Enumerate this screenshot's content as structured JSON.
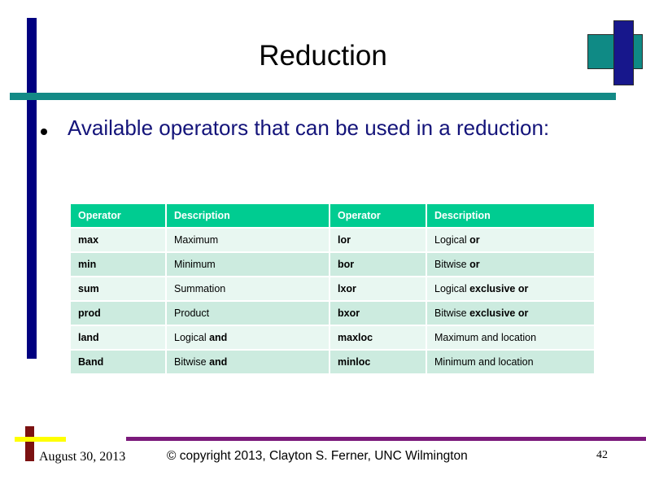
{
  "slide": {
    "title": "Reduction",
    "bullet": "Available operators that can be used in a reduction:",
    "accent_teal": "#138a86",
    "accent_navy": "#000080",
    "accent_bright_green": "#00cc91",
    "accent_purple": "#7b1a7b",
    "accent_dark_red": "#7b1111",
    "accent_yellow": "#ffff00",
    "bullet_text_color": "#14147a"
  },
  "table": {
    "headers": [
      "Operator",
      "Description",
      "Operator",
      "Description"
    ],
    "rows": [
      {
        "op1": "max",
        "desc1_plain": "Maximum",
        "desc1_bold": "",
        "op2": "lor",
        "desc2_plain": "Logical ",
        "desc2_bold": "or"
      },
      {
        "op1": "min",
        "desc1_plain": "Minimum",
        "desc1_bold": "",
        "op2": "bor",
        "desc2_plain": "Bitwise ",
        "desc2_bold": "or"
      },
      {
        "op1": "sum",
        "desc1_plain": "Summation",
        "desc1_bold": "",
        "op2": "lxor",
        "desc2_plain": "Logical ",
        "desc2_bold": "exclusive or"
      },
      {
        "op1": "prod",
        "desc1_plain": "Product",
        "desc1_bold": "",
        "op2": "bxor",
        "desc2_plain": "Bitwise ",
        "desc2_bold": "exclusive or"
      },
      {
        "op1": "land",
        "desc1_plain": "Logical ",
        "desc1_bold": "and",
        "op2": "maxloc",
        "desc2_plain": "Maximum and location",
        "desc2_bold": ""
      },
      {
        "op1": "Band",
        "desc1_plain": "Bitwise ",
        "desc1_bold": "and",
        "op2": "minloc",
        "desc2_plain": "Minimum and location",
        "desc2_bold": ""
      }
    ]
  },
  "footer": {
    "date": "August 30, 2013",
    "copyright": "© copyright 2013, Clayton S. Ferner, UNC Wilmington",
    "page_number": "42"
  }
}
